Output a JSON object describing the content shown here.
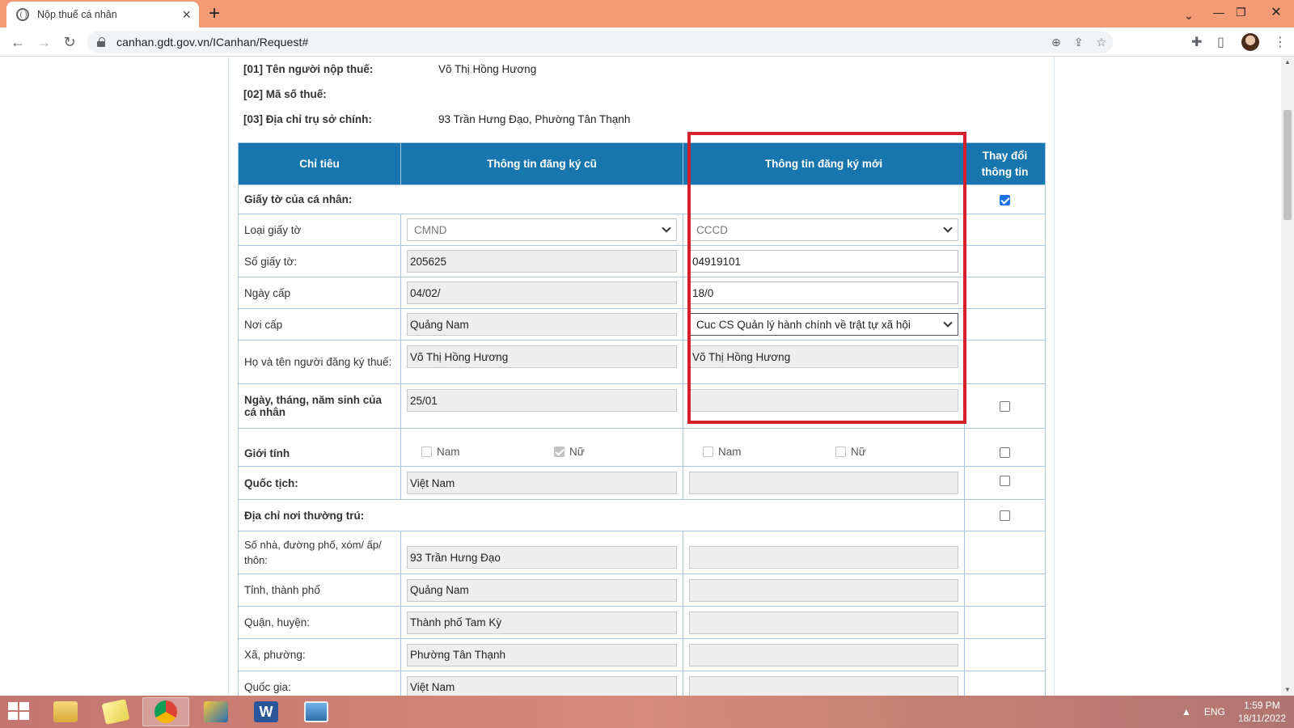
{
  "browser": {
    "tab_title": "Nộp thuế cá nhân",
    "url": "canhan.gdt.gov.vn/ICanhan/Request#"
  },
  "header": {
    "rows": [
      {
        "label": "[01] Tên người nộp thuế:",
        "value": "Võ Thị Hồng Hương"
      },
      {
        "label": "[02] Mã số thuế:",
        "value": ""
      },
      {
        "label": "[03] Địa chỉ trụ sở chính:",
        "value": "93 Trần Hưng Đạo, Phường Tân Thạnh"
      }
    ]
  },
  "table": {
    "headers": [
      "Chỉ tiêu",
      "Thông tin đăng ký cũ",
      "Thông tin đăng ký mới",
      "Thay đổi thông tin"
    ],
    "personal_docs": {
      "label": "Giấy tờ của cá nhân:",
      "checked": true
    },
    "doc_type": {
      "label": "Loại giấy tờ",
      "old": "CMND",
      "new": "CCCD"
    },
    "doc_number": {
      "label": "Số giấy tờ:",
      "old": "205625",
      "new": "04919101"
    },
    "issue_date": {
      "label": "Ngày cấp",
      "old": "04/02/",
      "new": "18/0"
    },
    "issue_place": {
      "label": "Nơi cấp",
      "old": "Quảng Nam",
      "new": "Cuc CS Quản lý hành chính về trật tự xã hội"
    },
    "full_name": {
      "label": "Họ và tên người đăng ký thuế:",
      "old": "Võ Thị Hồng Hương",
      "new": "Võ Thị Hồng Hương"
    },
    "birth_date": {
      "label": "Ngày, tháng, năm sinh của cá nhân",
      "old": "25/01",
      "new": "",
      "checked": false
    },
    "gender": {
      "label": "Giới tính",
      "male": "Nam",
      "female": "Nữ",
      "old_female_checked": true,
      "checked": false
    },
    "nationality": {
      "label": "Quốc tịch:",
      "old": "Việt Nam",
      "new": "",
      "checked": false
    },
    "residence": {
      "label": "Địa chỉ nơi thường trú:",
      "checked": false
    },
    "street": {
      "label": "Số nhà, đường phố, xóm/ ấp/ thôn:",
      "old": "93 Trần Hưng Đạo",
      "new": ""
    },
    "province": {
      "label": "Tỉnh, thành phố",
      "old": "Quảng Nam",
      "new": ""
    },
    "district": {
      "label": "Quận, huyện:",
      "old": "Thành phố Tam Kỳ",
      "new": ""
    },
    "ward": {
      "label": "Xã, phường:",
      "old": "Phường Tân Thạnh",
      "new": ""
    },
    "country": {
      "label": "Quốc gia:",
      "old": "Việt Nam",
      "new": ""
    }
  },
  "taskbar": {
    "apps": [
      "windows-explorer",
      "sticky-notes",
      "chrome",
      "onenote",
      "word",
      "photos"
    ],
    "language": "ENG",
    "time": "1:59 PM",
    "date": "18/11/2022"
  },
  "colors": {
    "header_blue": "#1776ae",
    "highlight_red": "#d4202b",
    "tabbar": "#f29b76"
  }
}
